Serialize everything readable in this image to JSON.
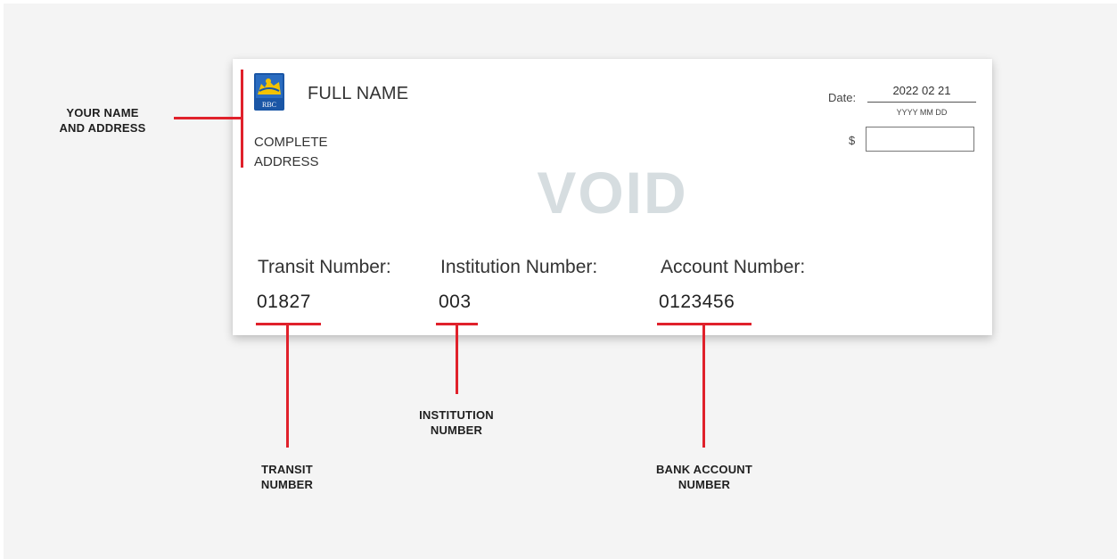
{
  "cheque": {
    "bank_logo": "rbc-lion-logo",
    "logo_text": "RBC",
    "full_name": "FULL NAME",
    "address_lines": [
      "COMPLETE",
      "ADDRESS"
    ],
    "date_label": "Date:",
    "date_value": "2022 02 21",
    "date_format": "YYYY MM DD",
    "currency_symbol": "$",
    "void_text": "VOID",
    "transit_label": "Transit Number:",
    "transit_value": "01827",
    "institution_label": "Institution Number:",
    "institution_value": "003",
    "account_label": "Account Number:",
    "account_value": "0123456"
  },
  "callouts": {
    "name_address": [
      "YOUR NAME",
      "AND ADDRESS"
    ],
    "transit": [
      "TRANSIT",
      "NUMBER"
    ],
    "institution": [
      "INSTITUTION",
      "NUMBER"
    ],
    "bank_account": [
      "BANK ACCOUNT",
      "NUMBER"
    ]
  },
  "colors": {
    "accent_red": "#e0212b",
    "void_watermark": "#d6dde0",
    "rbc_blue": "#1a56a6",
    "rbc_yellow": "#f3c200",
    "background": "#f4f4f4"
  }
}
